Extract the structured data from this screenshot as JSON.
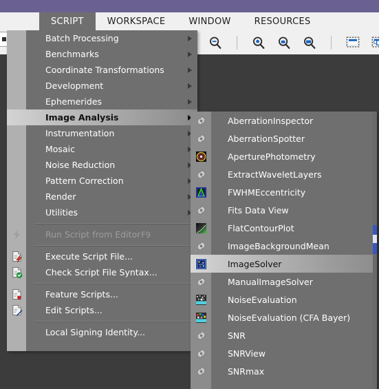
{
  "titlebar": {
    "color": "#6a6192"
  },
  "menubar": {
    "items": [
      {
        "label": "SCRIPT",
        "active": true
      },
      {
        "label": "WORKSPACE",
        "active": false
      },
      {
        "label": "WINDOW",
        "active": false
      },
      {
        "label": "RESOURCES",
        "active": false
      }
    ]
  },
  "toolbar": {
    "buttons": [
      {
        "name": "zoom-out-icon",
        "title": "Zoom Out"
      },
      {
        "name": "zoom-in-icon",
        "title": "Zoom In"
      },
      {
        "name": "zoom-fit-icon",
        "title": "Zoom To Fit"
      },
      {
        "name": "zoom-optimal-icon",
        "title": "Optimal Fit"
      },
      {
        "name": "window-single-icon",
        "title": "Fit Window"
      },
      {
        "name": "window-all-icon",
        "title": "Fit All Windows"
      },
      {
        "name": "window-resize-icon",
        "title": "Resize Window"
      }
    ]
  },
  "script_menu": {
    "rows": [
      {
        "type": "item",
        "label": "Batch Processing",
        "submenu": true,
        "icon": null,
        "accel": "",
        "disabled": false,
        "highlight": false
      },
      {
        "type": "item",
        "label": "Benchmarks",
        "submenu": true,
        "icon": null,
        "accel": "",
        "disabled": false,
        "highlight": false
      },
      {
        "type": "item",
        "label": "Coordinate Transformations",
        "submenu": true,
        "icon": null,
        "accel": "",
        "disabled": false,
        "highlight": false
      },
      {
        "type": "item",
        "label": "Development",
        "submenu": true,
        "icon": null,
        "accel": "",
        "disabled": false,
        "highlight": false
      },
      {
        "type": "item",
        "label": "Ephemerides",
        "submenu": true,
        "icon": null,
        "accel": "",
        "disabled": false,
        "highlight": false
      },
      {
        "type": "item",
        "label": "Image Analysis",
        "submenu": true,
        "icon": null,
        "accel": "",
        "disabled": false,
        "highlight": true
      },
      {
        "type": "item",
        "label": "Instrumentation",
        "submenu": true,
        "icon": null,
        "accel": "",
        "disabled": false,
        "highlight": false
      },
      {
        "type": "item",
        "label": "Mosaic",
        "submenu": true,
        "icon": null,
        "accel": "",
        "disabled": false,
        "highlight": false
      },
      {
        "type": "item",
        "label": "Noise Reduction",
        "submenu": true,
        "icon": null,
        "accel": "",
        "disabled": false,
        "highlight": false
      },
      {
        "type": "item",
        "label": "Pattern Correction",
        "submenu": true,
        "icon": null,
        "accel": "",
        "disabled": false,
        "highlight": false
      },
      {
        "type": "item",
        "label": "Render",
        "submenu": true,
        "icon": null,
        "accel": "",
        "disabled": false,
        "highlight": false
      },
      {
        "type": "item",
        "label": "Utilities",
        "submenu": true,
        "icon": null,
        "accel": "",
        "disabled": false,
        "highlight": false
      },
      {
        "type": "separator"
      },
      {
        "type": "item",
        "label": "Run Script from Editor",
        "submenu": false,
        "icon": "lightning-bolt-icon",
        "accel": "F9",
        "disabled": true,
        "highlight": false
      },
      {
        "type": "separator"
      },
      {
        "type": "item",
        "label": "Execute Script File...",
        "submenu": false,
        "icon": "script-execute-icon",
        "accel": "",
        "disabled": false,
        "highlight": false
      },
      {
        "type": "item",
        "label": "Check Script File Syntax...",
        "submenu": false,
        "icon": "script-check-icon",
        "accel": "",
        "disabled": false,
        "highlight": false
      },
      {
        "type": "separator"
      },
      {
        "type": "item",
        "label": "Feature Scripts...",
        "submenu": false,
        "icon": "script-favorite-icon",
        "accel": "",
        "disabled": false,
        "highlight": false
      },
      {
        "type": "item",
        "label": "Edit Scripts...",
        "submenu": false,
        "icon": "script-edit-icon",
        "accel": "",
        "disabled": false,
        "highlight": false
      },
      {
        "type": "separator"
      },
      {
        "type": "item",
        "label": "Local Signing Identity...",
        "submenu": false,
        "icon": null,
        "accel": "",
        "disabled": false,
        "highlight": false
      }
    ]
  },
  "image_analysis_submenu": {
    "rows": [
      {
        "label": "AberrationInspector",
        "icon": "gear-icon",
        "highlight": false
      },
      {
        "label": "AberrationSpotter",
        "icon": "gear-icon",
        "highlight": false
      },
      {
        "label": "AperturePhotometry",
        "icon": "aperture-photometry-icon",
        "highlight": false
      },
      {
        "label": "ExtractWaveletLayers",
        "icon": "gear-icon",
        "highlight": false
      },
      {
        "label": "FWHMEccentricity",
        "icon": "fwhm-eccentricity-icon",
        "highlight": false
      },
      {
        "label": "Fits Data View",
        "icon": "gear-icon",
        "highlight": false
      },
      {
        "label": "FlatContourPlot",
        "icon": "flat-contour-plot-icon",
        "highlight": false
      },
      {
        "label": "ImageBackgroundMean",
        "icon": "gear-icon",
        "highlight": false
      },
      {
        "label": "ImageSolver",
        "icon": "image-solver-icon",
        "highlight": true
      },
      {
        "label": "ManualImageSolver",
        "icon": "gear-icon",
        "highlight": false
      },
      {
        "label": "NoiseEvaluation",
        "icon": "noise-evaluation-icon",
        "highlight": false
      },
      {
        "label": "NoiseEvaluation (CFA Bayer)",
        "icon": "noise-evaluation-cfa-icon",
        "highlight": false
      },
      {
        "label": "SNR",
        "icon": "gear-icon",
        "highlight": false
      },
      {
        "label": "SNRView",
        "icon": "gear-icon",
        "highlight": false
      },
      {
        "label": "SNRmax",
        "icon": "gear-icon",
        "highlight": false
      }
    ],
    "scrollbar": {
      "color": "#3858c0"
    }
  }
}
